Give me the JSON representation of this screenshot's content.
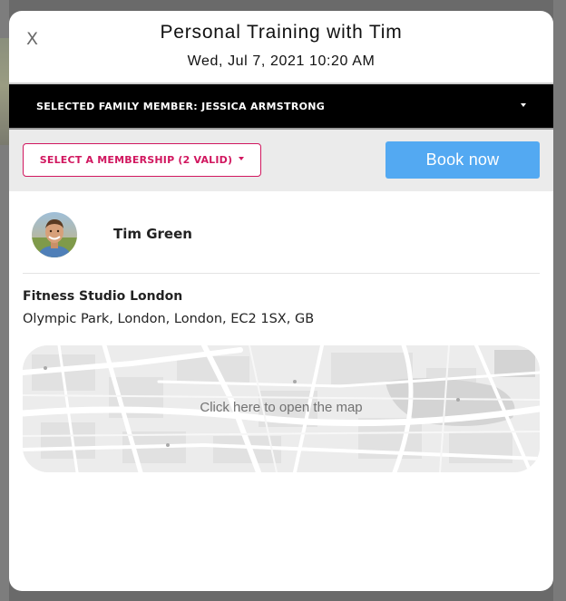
{
  "modal": {
    "close_label": "X",
    "title": "Personal Training with Tim",
    "datetime": "Wed, Jul 7, 2021 10:20 AM"
  },
  "family_member": {
    "label": "SELECTED FAMILY MEMBER: JESSICA ARMSTRONG",
    "icon": "caret-down-icon"
  },
  "actions": {
    "membership_label": "SELECT A MEMBERSHIP (2 VALID)",
    "book_label": "Book now"
  },
  "trainer": {
    "name": "Tim Green",
    "avatar_icon": "trainer-avatar"
  },
  "venue": {
    "name": "Fitness Studio London",
    "address": "Olympic Park, London, London, EC2 1SX, GB"
  },
  "map": {
    "prompt": "Click here to open the map"
  },
  "colors": {
    "accent_pink": "#d1175f",
    "book_blue": "#53a9f2",
    "family_bar": "#000000"
  }
}
